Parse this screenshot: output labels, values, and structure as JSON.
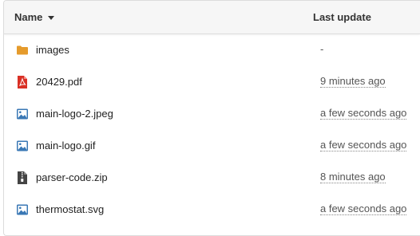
{
  "table": {
    "columns": {
      "name": "Name",
      "last_update": "Last update"
    },
    "rows": [
      {
        "name": "images",
        "updated": "-",
        "icon": "folder-icon"
      },
      {
        "name": "20429.pdf",
        "updated": "9 minutes ago",
        "icon": "pdf-icon"
      },
      {
        "name": "main-logo-2.jpeg",
        "updated": "a few seconds ago",
        "icon": "image-icon"
      },
      {
        "name": "main-logo.gif",
        "updated": "a few seconds ago",
        "icon": "image-icon"
      },
      {
        "name": "parser-code.zip",
        "updated": "8 minutes ago",
        "icon": "zip-icon"
      },
      {
        "name": "thermostat.svg",
        "updated": "a few seconds ago",
        "icon": "image-icon"
      }
    ]
  },
  "colors": {
    "folder": "#e59b2c",
    "pdf": "#d93025",
    "image": "#3a78b5",
    "zip": "#444444"
  }
}
